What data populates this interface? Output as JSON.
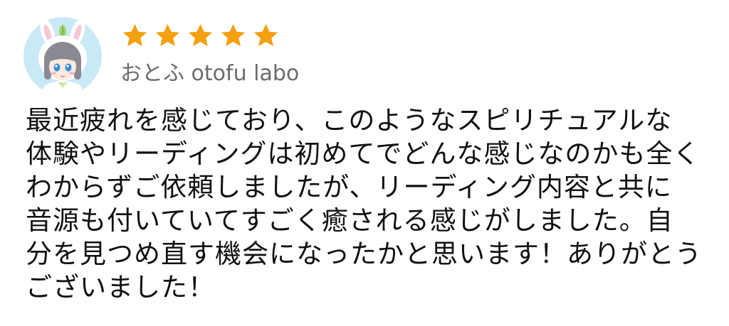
{
  "review": {
    "rating": 5,
    "rating_max": 5,
    "star_color": "#f5a010",
    "reviewer_name": "おとふ otofu labo",
    "avatar_icon": "bunny-hood-girl-avatar",
    "body_lines": [
      "最近疲れを感じており、このようなスピリチュアルな",
      "体験やリーディングは初めてでどんな感じなのかも全く",
      "わからずご依頼しましたが、リーディング内容と共に",
      "音源も付いていてすごく癒される感じがしました。自",
      "分を見つめ直す機会になったかと思います！ありがとう",
      "ございました！"
    ]
  }
}
